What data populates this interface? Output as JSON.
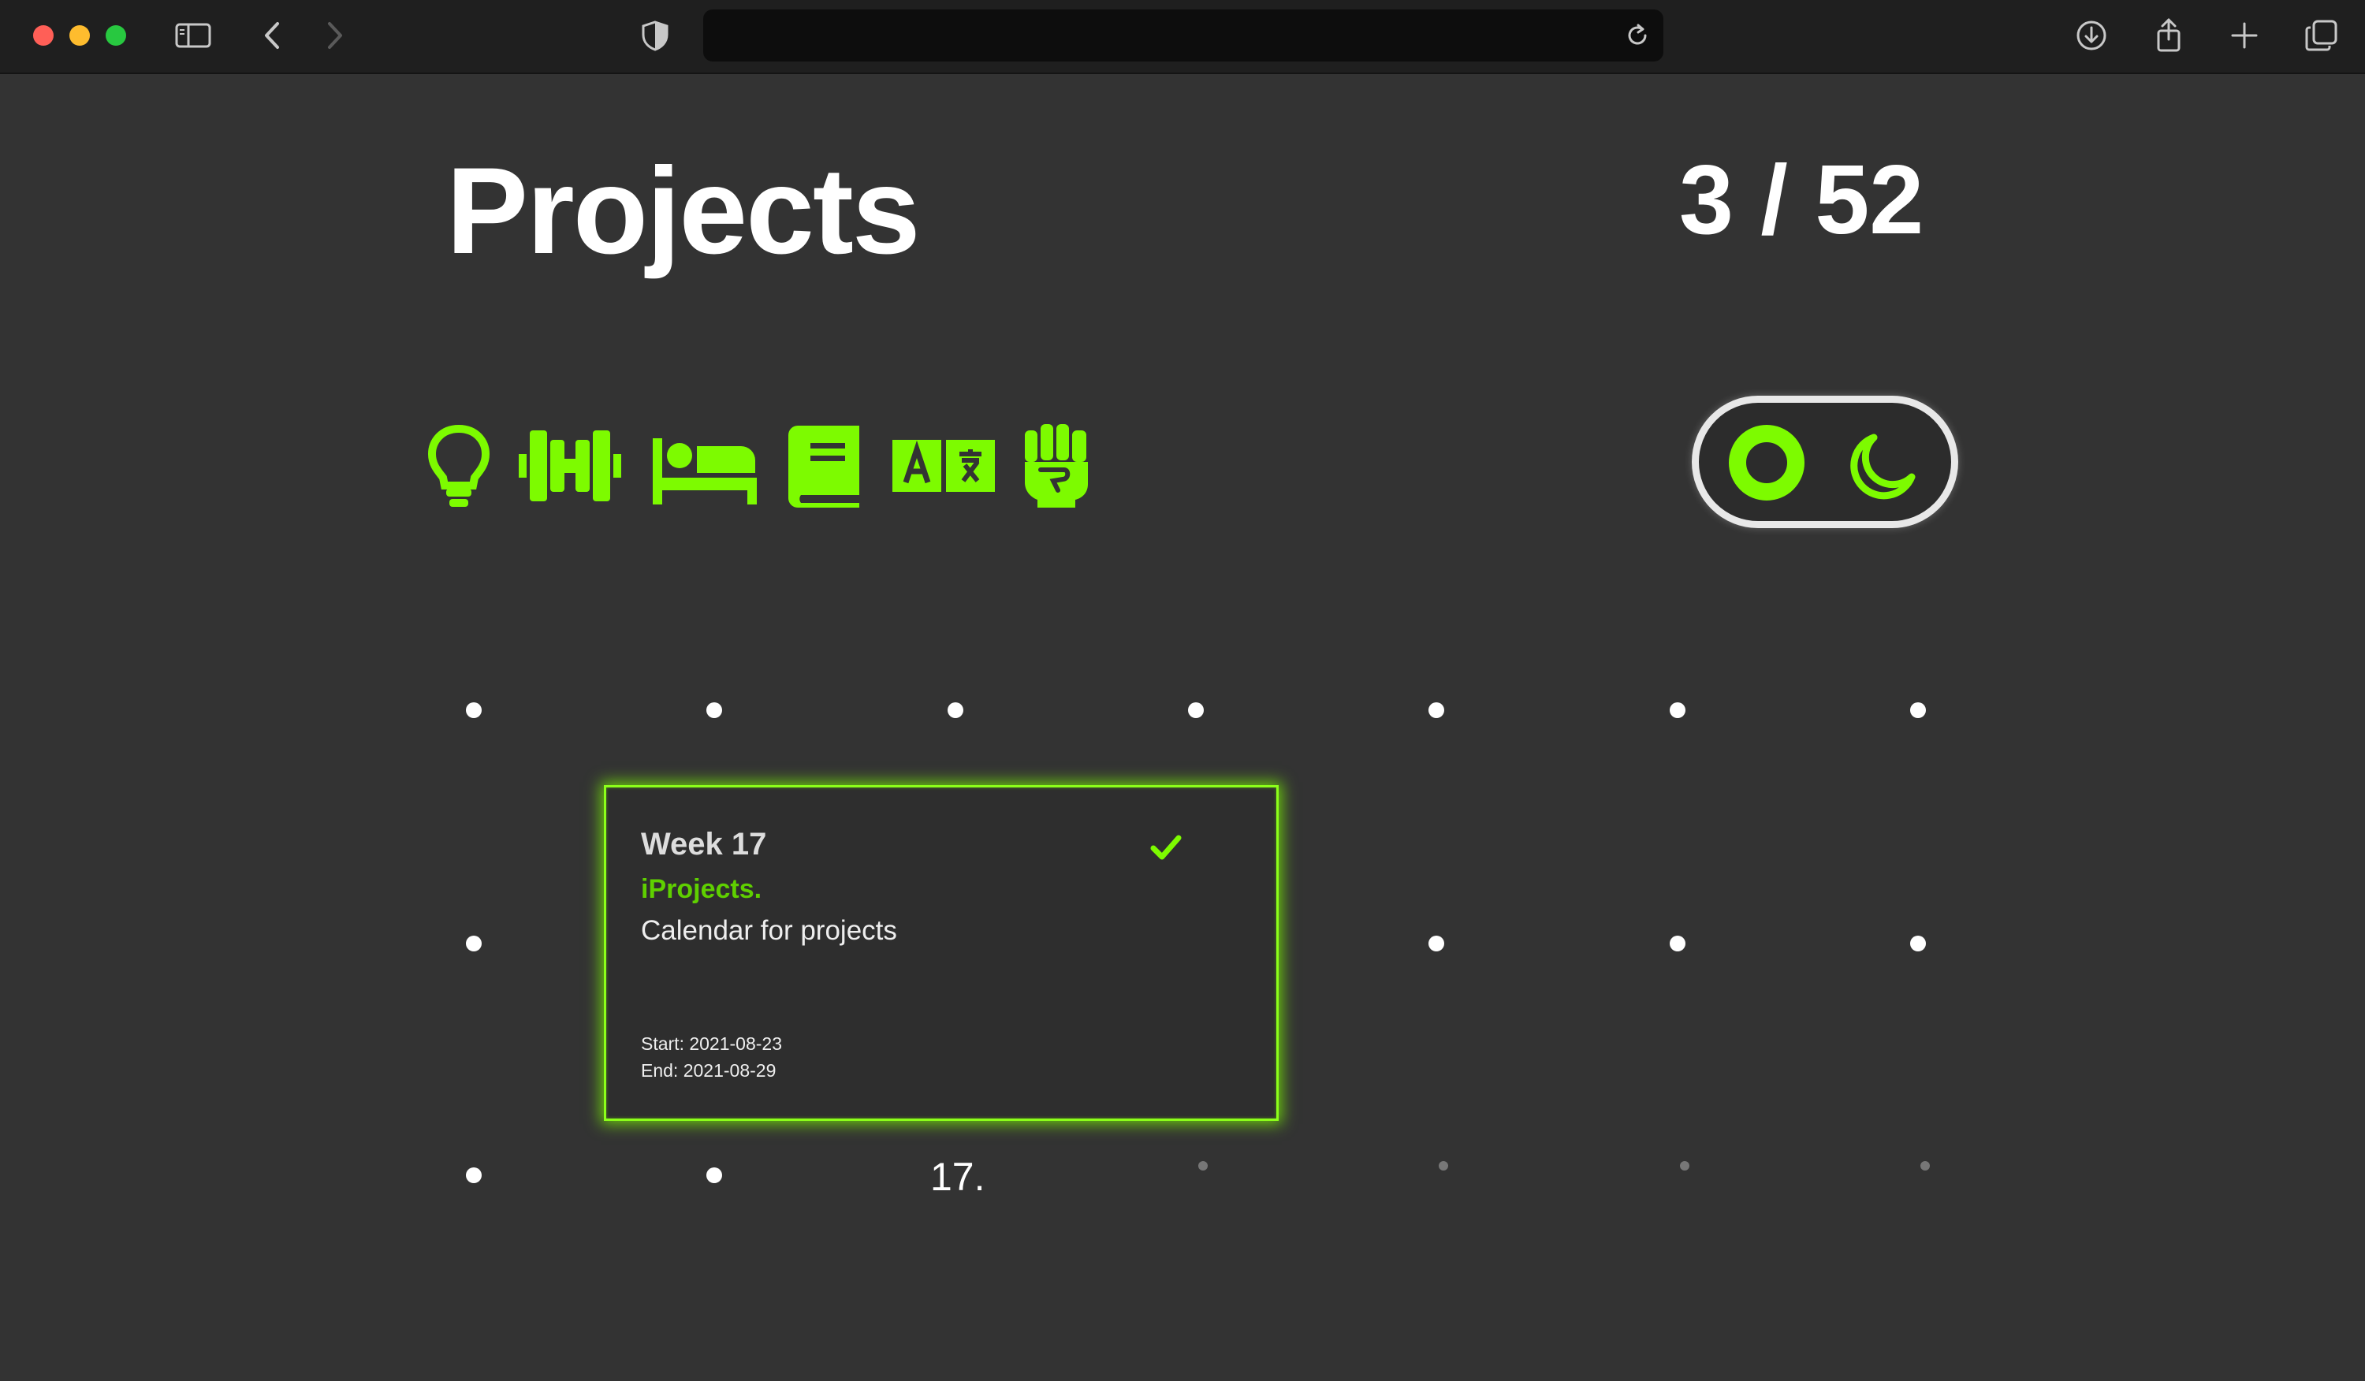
{
  "header": {
    "title": "Projects",
    "progress_text": "3 / 52",
    "progress": {
      "completed": 3,
      "total": 52
    }
  },
  "categories": [
    {
      "name": "lightbulb-icon"
    },
    {
      "name": "dumbbell-icon"
    },
    {
      "name": "bed-icon"
    },
    {
      "name": "book-icon"
    },
    {
      "name": "translate-icon"
    },
    {
      "name": "fist-icon"
    }
  ],
  "theme_toggle": {
    "state": "dark"
  },
  "card": {
    "week": "Week 17",
    "project": "iProjects.",
    "description": "Calendar for projects",
    "start": "Start: 2021-08-23",
    "end": "End: 2021-08-29",
    "completed": true
  },
  "week_label": "17.",
  "colors": {
    "accent": "#7dfb00",
    "background": "#333333",
    "text": "#ffffff"
  }
}
